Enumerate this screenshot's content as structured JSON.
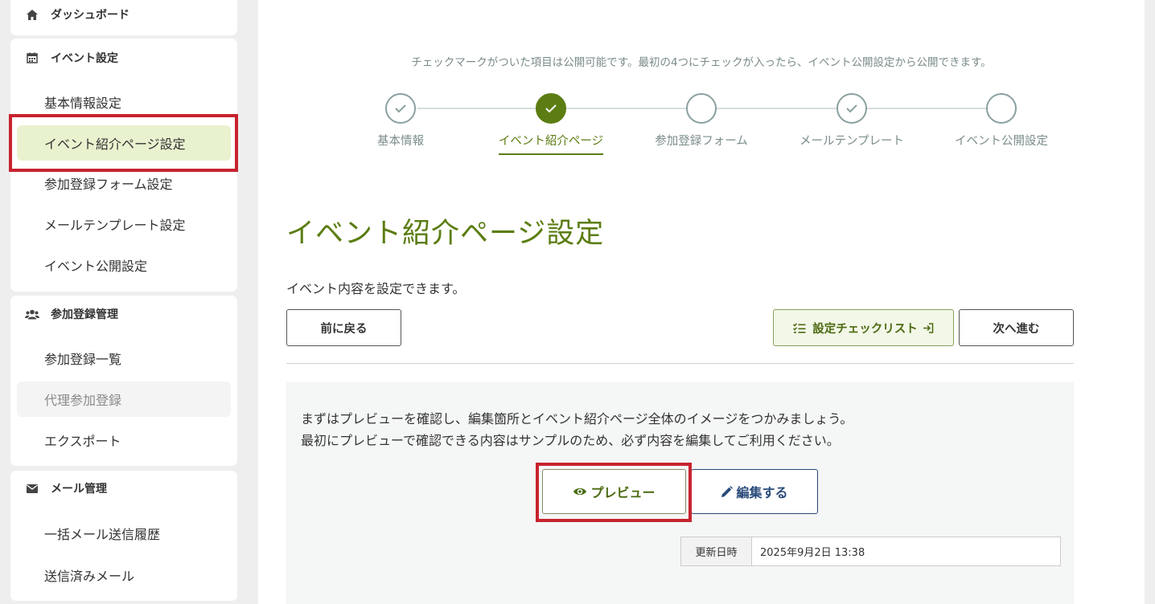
{
  "sidebar": {
    "dashboard": {
      "label": "ダッシュボード",
      "icon": "home-icon"
    },
    "event_settings": {
      "label": "イベント設定",
      "icon": "calendar-icon",
      "items": [
        {
          "label": "基本情報設定"
        },
        {
          "label": "イベント紹介ページ設定",
          "active": true
        },
        {
          "label": "参加登録フォーム設定"
        },
        {
          "label": "メールテンプレート設定"
        },
        {
          "label": "イベント公開設定"
        }
      ]
    },
    "registration": {
      "label": "参加登録管理",
      "icon": "users-icon",
      "items": [
        {
          "label": "参加登録一覧"
        },
        {
          "label": "代理参加登録",
          "disabled": true
        },
        {
          "label": "エクスポート"
        }
      ]
    },
    "mail": {
      "label": "メール管理",
      "icon": "envelope-icon",
      "items": [
        {
          "label": "一括メール送信履歴"
        },
        {
          "label": "送信済みメール"
        }
      ]
    }
  },
  "main": {
    "instruction": "チェックマークがついた項目は公開可能です。最初の4つにチェックが入ったら、イベント公開設定から公開できます。",
    "steps": [
      {
        "label": "基本情報",
        "state": "done"
      },
      {
        "label": "イベント紹介ページ",
        "state": "current"
      },
      {
        "label": "参加登録フォーム",
        "state": "empty"
      },
      {
        "label": "メールテンプレート",
        "state": "done"
      },
      {
        "label": "イベント公開設定",
        "state": "empty"
      }
    ],
    "title": "イベント紹介ページ設定",
    "description": "イベント内容を設定できます。",
    "buttons": {
      "back": "前に戻る",
      "checklist": "設定チェックリスト",
      "next": "次へ進む"
    },
    "panel": {
      "line1": "まずはプレビューを確認し、編集箇所とイベント紹介ページ全体のイメージをつかみましょう。",
      "line2": "最初にプレビューで確認できる内容はサンプルのため、必ず内容を編集してご利用ください。",
      "preview_label": "プレビュー",
      "edit_label": "編集する",
      "updated_key": "更新日時",
      "updated_value": "2025年9月2日 13:38"
    }
  },
  "colors": {
    "accent": "#5b7d12",
    "active_bg": "#e9f2cf",
    "highlight": "#c7232e",
    "edit": "#2a4b7a"
  }
}
